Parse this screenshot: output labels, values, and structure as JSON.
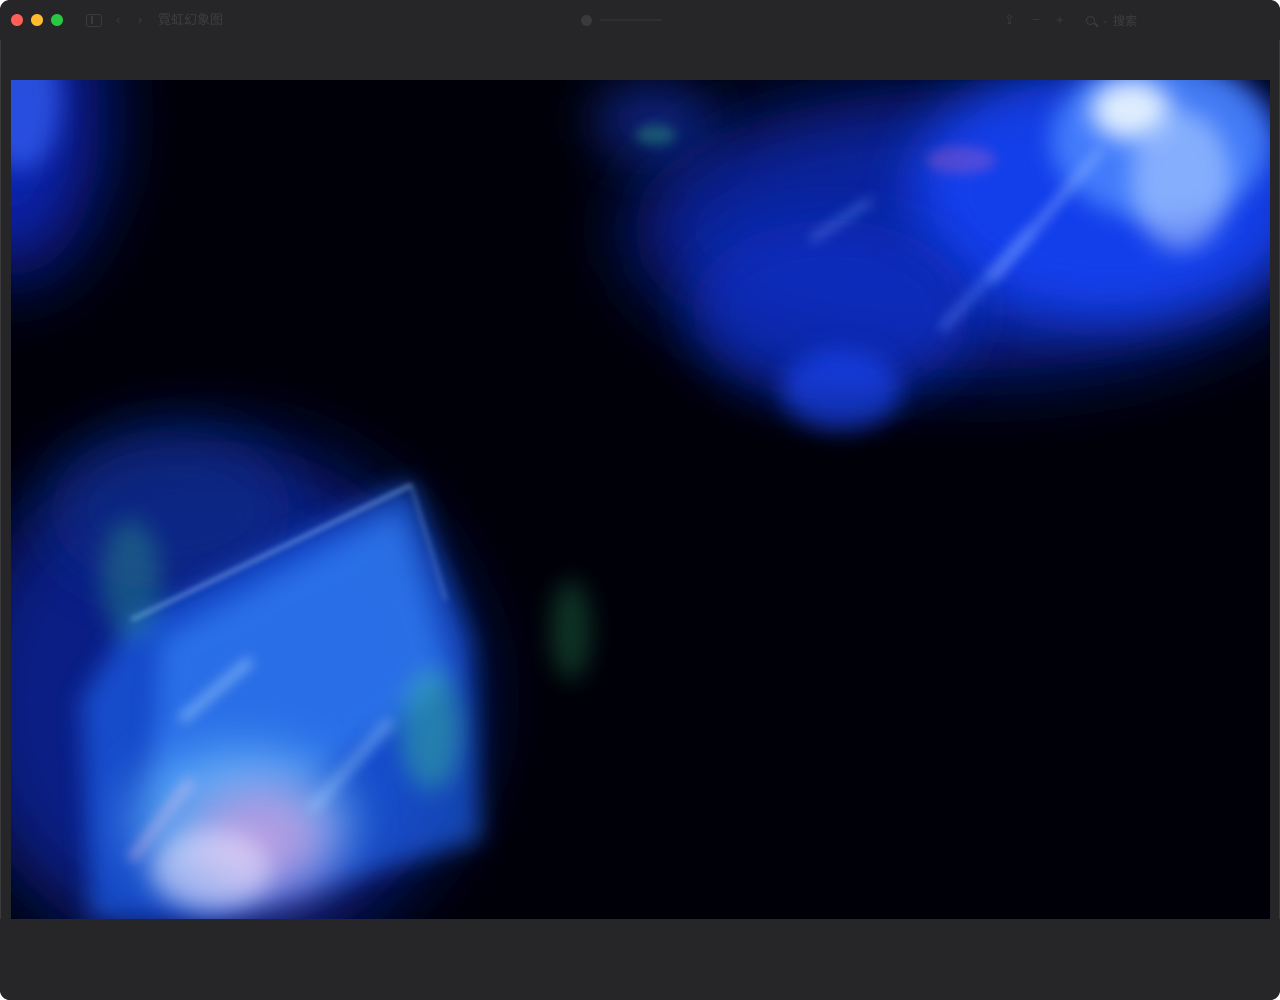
{
  "window": {
    "title": "霓虹幻象图",
    "search_label": "搜索"
  },
  "toolbar": {
    "sidebar_icon": "sidebar-icon",
    "back_icon": "chevron-left-icon",
    "forward_icon": "chevron-right-icon",
    "record_icon": "record-dot-icon",
    "share_icon": "share-icon",
    "zoom_out_icon": "zoom-out-icon",
    "zoom_in_icon": "zoom-in-icon",
    "search_icon": "search-icon"
  },
  "image": {
    "description_colors": {
      "background": "#000008",
      "primary_glow": "#1f5cff",
      "highlight": "#e8f4ff",
      "accent_pink": "#ff9ad8",
      "accent_green": "#3fe08a"
    }
  },
  "colors": {
    "window_bg": "#262628",
    "close": "#ff5f57",
    "minimize": "#febc2e",
    "maximize": "#28c840"
  }
}
